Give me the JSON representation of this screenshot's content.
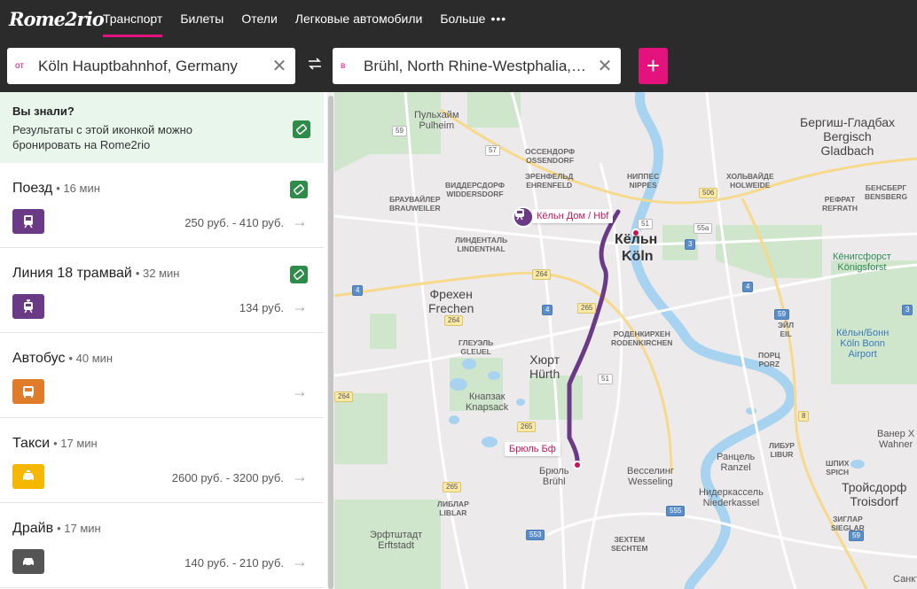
{
  "brand": {
    "logo": "Rome2rio",
    "accent": "#e3127c"
  },
  "nav": {
    "items": [
      "Транспорт",
      "Билеты",
      "Отели",
      "Легковые автомобили",
      "Больше"
    ],
    "more_dots": "•••"
  },
  "search": {
    "from_tag": "от",
    "from_value": "Köln Hauptbahnhof, Germany",
    "to_tag": "в",
    "to_value": "Brühl, North Rhine-Westphalia, Germany",
    "add_label": "+"
  },
  "tip": {
    "title": "Вы знали?",
    "text": "Результаты с этой иконкой можно бронировать на Rome2rio"
  },
  "routes": [
    {
      "name": "Поезд",
      "duration": "• 16 мин",
      "price": "250 руб. - 410 руб.",
      "bookable": true,
      "mode_icon": "train-icon",
      "color": "#6b3a87"
    },
    {
      "name": "Линия 18 трамвай",
      "duration": "• 32 мин",
      "price": "134 руб.",
      "bookable": true,
      "mode_icon": "tram-icon",
      "color": "#6b3a87"
    },
    {
      "name": "Автобус",
      "duration": "• 40 мин",
      "price": "",
      "bookable": false,
      "mode_icon": "bus-icon",
      "color": "#e07b2a"
    },
    {
      "name": "Такси",
      "duration": "• 17 мин",
      "price": "2600 руб. - 3200 руб.",
      "bookable": false,
      "mode_icon": "taxi-icon",
      "color": "#f5b700"
    },
    {
      "name": "Драйв",
      "duration": "• 17 мин",
      "price": "140 руб. - 210 руб.",
      "bookable": false,
      "mode_icon": "car-icon",
      "color": "#555555"
    }
  ],
  "map": {
    "station_from": "Кёльн Дом / Hbf",
    "station_to": "Брюль Бф",
    "labels": {
      "pulheim": "Пульхайм\nPulheim",
      "bergisch": "Бергиш-Гладбах\nBergisch\nGladbach",
      "ossendorf": "ОССЕНДОРФ\nOSSENDORF",
      "widdersdorf": "ВИДДЕРСДОРФ\nWIDDERSDORF",
      "ehrenfeld": "ЭРЕНФЕЛЬД\nEHRENFELD",
      "nippes": "НИППЕС\nNIPPES",
      "holweide": "ХОЛЬВАЙДЕ\nHOLWEIDE",
      "bensberg": "БЕНСБЕРГ\nBENSBERG",
      "refrath": "РЕФРАТ\nREFRATH",
      "brauweiler": "БРАУВАЙЛЕР\nBRAUWEILER",
      "lindenthal": "ЛИНДЕНТАЛЬ\nLINDENTHAL",
      "koeln_ru": "Кёльн",
      "koeln": "Köln",
      "koenigsforst": "Кёнигсфорст\nKönigsforst",
      "frechen": "Фрехен\nFrechen",
      "gleuel": "ГЛЕУЭЛЬ\nGLEUEL",
      "rodenkirchen": "РОДЕНКИРХЕН\nRODENKIRCHEN",
      "porz": "ПОРЦ\nPORZ",
      "eil": "ЭЙЛ\nEIL",
      "airport": "Кёльн/Бонн\nKöln Bonn\nAirport",
      "huerth": "Хюрт\nHürth",
      "knapsack": "Кнапзак\nKnapsack",
      "libur": "ЛИБУР\nLIBUR",
      "wahner": "Ванер Х\nWahner",
      "ranzel": "Ранцель\nRanzel",
      "spich": "ШПИХ\nSPICH",
      "bruehl": "Брюль\nBrühl",
      "wesseling": "Весселинг\nWesseling",
      "troisdorf": "Тройсдорф\nTroisdorf",
      "niederkassel": "Нидеркассель\nNiederkassel",
      "liblar": "ЛИБЛАР\nLIBLAR",
      "sieglar": "ЗИГЛАР\nSIEGLAR",
      "erftstadt": "Эрфтштадт\nErftstadt",
      "sechtem": "ЗЕХТЕМ\nSECHTEM",
      "sankt": "Санкт"
    },
    "shields": [
      "59",
      "57",
      "506",
      "51",
      "55a",
      "3",
      "4",
      "264",
      "264",
      "4",
      "265",
      "59",
      "51",
      "264",
      "265",
      "8",
      "265",
      "553",
      "555",
      "59",
      "3",
      "4"
    ]
  }
}
